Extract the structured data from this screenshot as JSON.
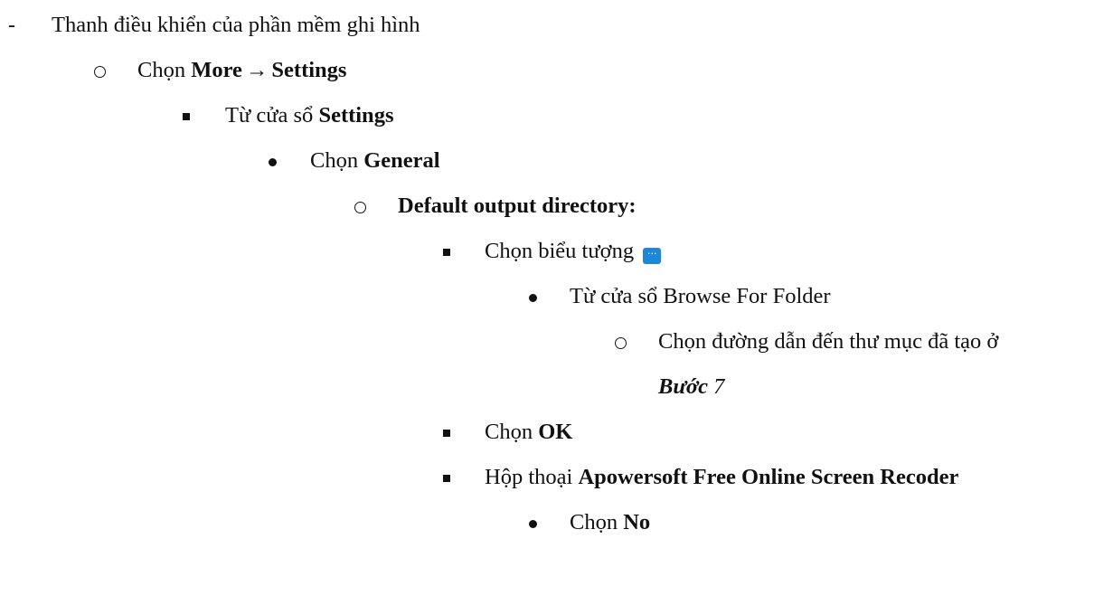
{
  "items": {
    "l1": {
      "text": "Thanh điều khiển của phần mềm ghi hình"
    },
    "l2": {
      "prefix": "Chọn ",
      "b1": "More",
      "arrow": "→",
      "b2": "Settings"
    },
    "l3": {
      "prefix": "Từ cửa sổ ",
      "b1": "Settings"
    },
    "l4": {
      "prefix": "Chọn ",
      "b1": "General"
    },
    "l5": {
      "b1": "Default output directory:"
    },
    "l6": {
      "prefix": "Chọn biểu tượng ",
      "icon_glyph": "···",
      "icon_name": "ellipsis-icon"
    },
    "l7": {
      "text": "Từ cửa sổ Browse For Folder"
    },
    "l8": {
      "text": "Chọn đường dẫn đến thư mục đã tạo ở"
    },
    "l9": {
      "bi": "Bước",
      "rest": " 7"
    },
    "l10": {
      "prefix": "Chọn ",
      "b1": "OK"
    },
    "l11": {
      "prefix": "Hộp thoại ",
      "b1": "Apowersoft Free Online Screen Recoder"
    },
    "l12": {
      "prefix": "Chọn ",
      "b1": "No"
    }
  },
  "colors": {
    "text": "#111111",
    "icon_bg": "#1e88d8"
  }
}
